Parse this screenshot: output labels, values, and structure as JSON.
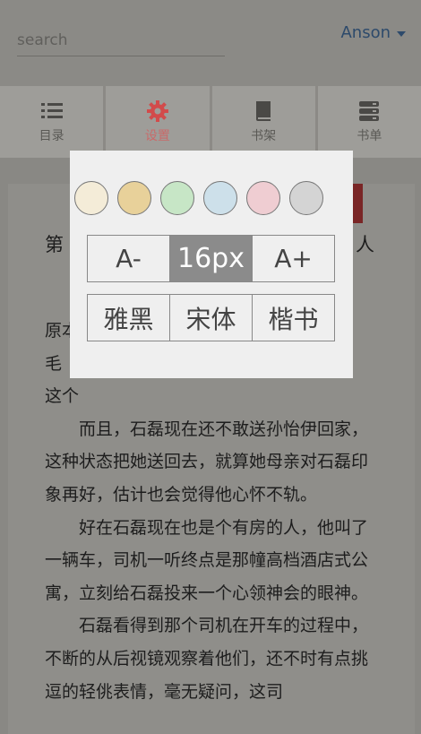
{
  "search": {
    "placeholder": "search"
  },
  "user": {
    "name": "Anson"
  },
  "tabs": [
    {
      "label": "目录",
      "icon": "list-icon"
    },
    {
      "label": "设置",
      "icon": "gear-icon",
      "active": true
    },
    {
      "label": "书架",
      "icon": "book-icon"
    },
    {
      "label": "书单",
      "icon": "stack-icon"
    }
  ],
  "settings": {
    "colors": [
      "#f4ecd8",
      "#e8d19a",
      "#c7e6c6",
      "#cde0ea",
      "#efcdd2",
      "#d4d4d4"
    ],
    "font_size": {
      "decrease": "A-",
      "value": "16px",
      "increase": "A+"
    },
    "fonts": [
      "雅黑",
      "宋体",
      "楷书"
    ]
  },
  "reader": {
    "chapter_title_left": "第",
    "chapter_title_right": "人",
    "lines_hidden_prefix": [
      "原本",
      "这个"
    ],
    "line1_suffix": "毛",
    "paragraphs": [
      "而且，石磊现在还不敢送孙怡伊回家，这种状态把她送回去，就算她母亲对石磊印象再好，估计也会觉得他心怀不轨。",
      "好在石磊现在也是个有房的人，他叫了一辆车，司机一听终点是那幢高档酒店式公寓，立刻给石磊投来一个心领神会的眼神。",
      "石磊看得到那个司机在开车的过程中，不断的从后视镜观察着他们，还不时有点挑逗的轻佻表情，毫无疑问，这司"
    ]
  }
}
